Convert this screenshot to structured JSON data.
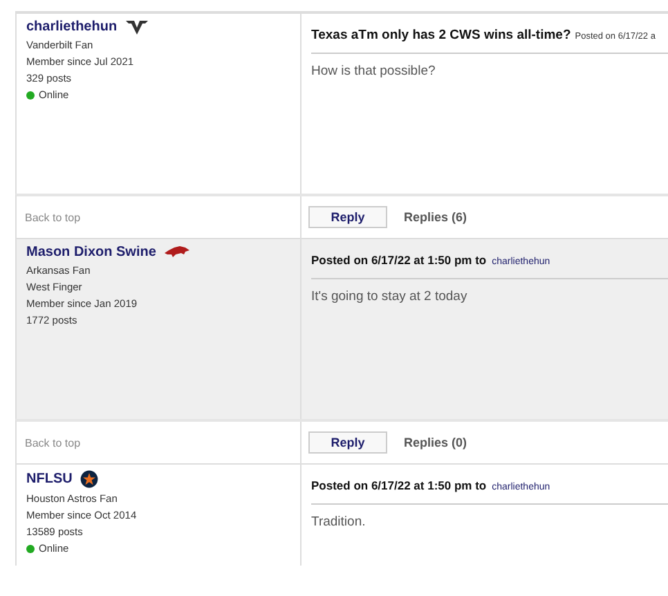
{
  "posts": [
    {
      "shaded": false,
      "user": {
        "name": "charliethehun",
        "kind": "v",
        "lines": [
          "Vanderbilt Fan",
          "Member since Jul 2021",
          "329 posts"
        ],
        "online": true,
        "status": "Online"
      },
      "header": {
        "title": "Texas aTm only has 2 CWS wins all-time?",
        "posted": "Posted on 6/17/22 a"
      },
      "body": "How is that possible?",
      "footer": {
        "back": "Back to top",
        "reply": "Reply",
        "replies": "Replies (6)"
      }
    },
    {
      "shaded": true,
      "user": {
        "name": "Mason Dixon Swine",
        "kind": "hog",
        "lines": [
          "Arkansas Fan",
          "West Finger",
          "Member since Jan 2019",
          "1772 posts"
        ],
        "online": false
      },
      "header": {
        "posted": "Posted on 6/17/22 at 1:50 pm to",
        "to": "charliethehun"
      },
      "body": "It's going to stay at 2 today",
      "footer": {
        "back": "Back to top",
        "reply": "Reply",
        "replies": "Replies (0)"
      }
    },
    {
      "shaded": false,
      "user": {
        "name": "NFLSU",
        "kind": "star",
        "lines": [
          "Houston Astros Fan",
          "Member since Oct 2014",
          "13589 posts"
        ],
        "online": true,
        "status": "Online"
      },
      "header": {
        "posted": "Posted on 6/17/22 at 1:50 pm to",
        "to": "charliethehun"
      },
      "body": "Tradition."
    }
  ]
}
